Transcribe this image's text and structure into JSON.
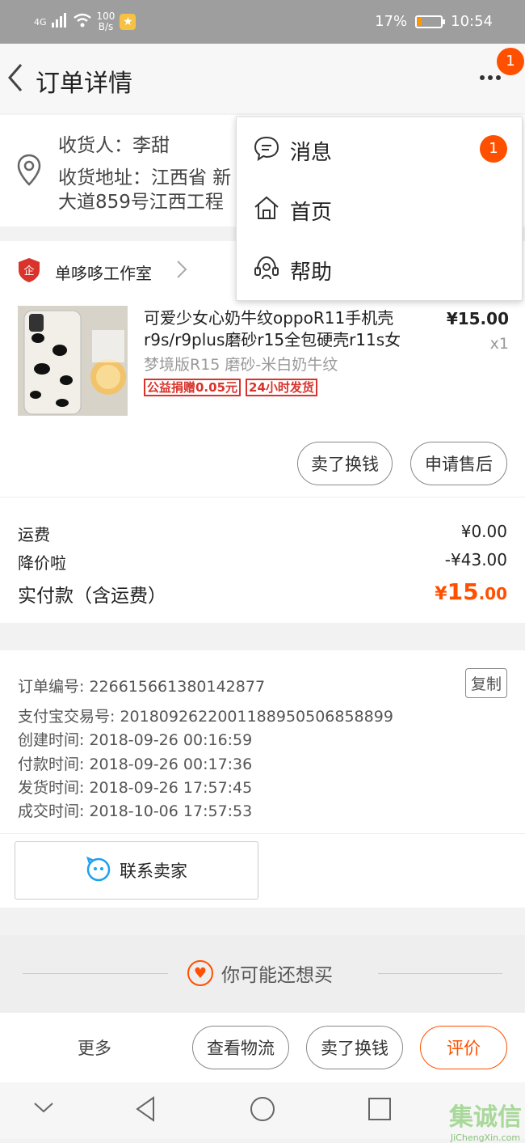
{
  "status_bar": {
    "network": "4G",
    "speed_value": "100",
    "speed_unit": "B/s",
    "battery": "17%",
    "battery_level": 0.17,
    "time": "10:54"
  },
  "header": {
    "title": "订单详情",
    "more_icon": "ellipsis-icon",
    "badge": "1"
  },
  "address": {
    "recipient_label": "收货人：",
    "recipient": "李甜",
    "address_label": "收货地址：",
    "address_line1": "江西省 新",
    "address_line2": "大道859号江西工程"
  },
  "shop": {
    "name": "单哆哆工作室",
    "logo_char": "企"
  },
  "product": {
    "title": "可爱少女心奶牛纹oppoR11手机壳r9s/r9plus磨砂r15全包硬壳r11s女",
    "variant": "梦境版R15 磨砂-米白奶牛纹",
    "tags": [
      "公益捐赠0.05元",
      "24小时发货"
    ],
    "price": "¥15.00",
    "qty": "x1",
    "buttons": {
      "exchange": "卖了换钱",
      "after_sale": "申请售后"
    }
  },
  "fees": {
    "shipping_label": "运费",
    "shipping_value": "¥0.00",
    "discount_label": "降价啦",
    "discount_value": "-¥43.00",
    "paid_label": "实付款（含运费）",
    "paid_currency": "¥",
    "paid_int": "15",
    "paid_dec": ".00"
  },
  "order_info": {
    "order_no": "订单编号: 226615661380142877",
    "copy": "复制",
    "alipay_no": "支付宝交易号: 2018092622001188950506858899",
    "created": "创建时间: 2018-09-26 00:16:59",
    "paid": "付款时间: 2018-09-26 00:17:36",
    "shipped": "发货时间: 2018-09-26 17:57:45",
    "completed": "成交时间: 2018-10-06 17:57:53",
    "contact": "联系卖家"
  },
  "recommend": {
    "label": "你可能还想买"
  },
  "bottom": {
    "more": "更多",
    "logistics": "查看物流",
    "exchange": "卖了换钱",
    "review": "评价"
  },
  "menu": {
    "items": [
      {
        "label": "消息",
        "icon": "chat-icon",
        "badge": "1"
      },
      {
        "label": "首页",
        "icon": "home-icon"
      },
      {
        "label": "帮助",
        "icon": "help-icon"
      }
    ]
  },
  "watermark": {
    "text": "集诚信",
    "sub": "JiChengXin.com"
  },
  "colors": {
    "accent": "#ff5000",
    "tag_red": "#d9332b"
  }
}
